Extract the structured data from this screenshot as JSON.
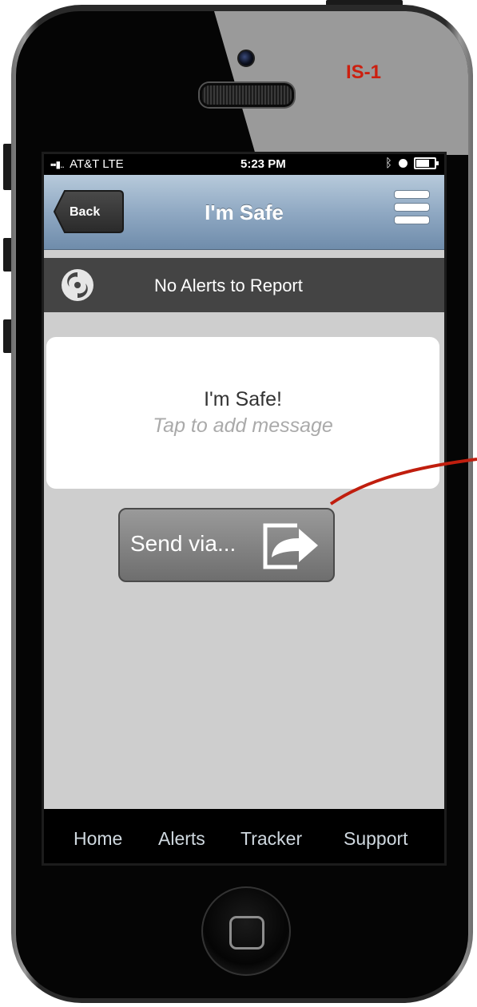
{
  "annotation": {
    "tag": "IS-1",
    "tag_color": "#cc1f0f",
    "arrow_color": "#c01e0e"
  },
  "status_bar": {
    "carrier": "AT&T LTE",
    "time": "5:23 PM",
    "icons": [
      "signal-icon",
      "bluetooth-icon",
      "alarm-icon",
      "battery-icon"
    ]
  },
  "nav_bar": {
    "back_label": "Back",
    "title": "I'm Safe",
    "menu_icon": "hamburger-menu-icon"
  },
  "alert_banner": {
    "icon": "hurricane-icon",
    "text": "No Alerts to Report"
  },
  "message_card": {
    "title": "I'm Safe!",
    "placeholder": "Tap to add message"
  },
  "send_button": {
    "label": "Send via...",
    "icon": "share-icon"
  },
  "tab_bar": {
    "tabs": [
      {
        "label": "Home"
      },
      {
        "label": "Alerts"
      },
      {
        "label": "Tracker"
      },
      {
        "label": "Support"
      }
    ]
  },
  "colors": {
    "nav_gradient_top": "#b7cadb",
    "nav_gradient_bottom": "#6f8cab",
    "screen_bg": "#cecece",
    "banner_bg": "#444444"
  }
}
